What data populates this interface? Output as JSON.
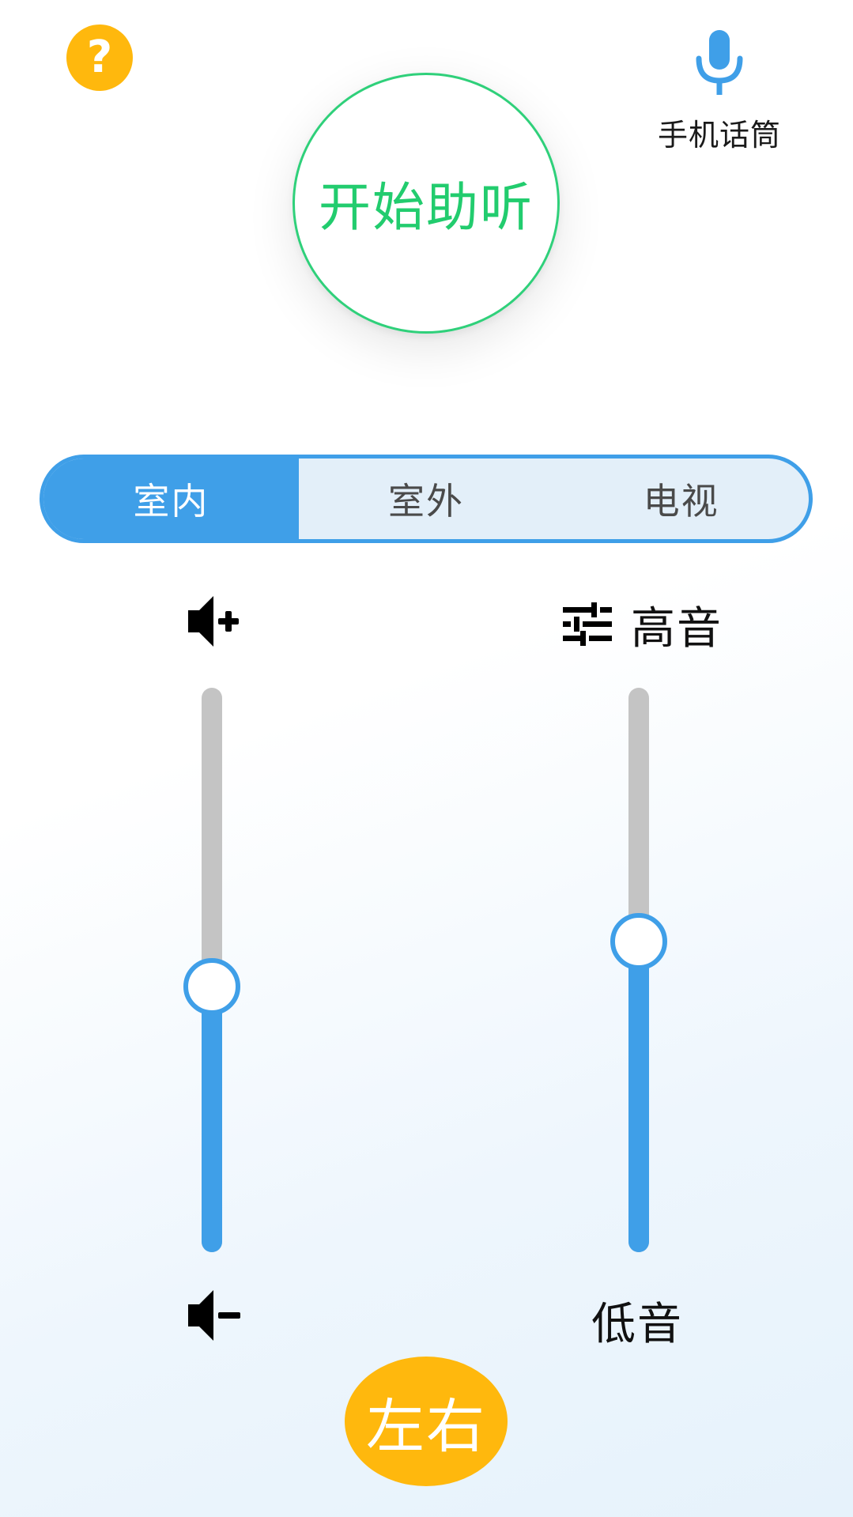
{
  "header": {
    "help_glyph": "?",
    "mic_label": "手机话筒"
  },
  "start_button": {
    "label": "开始助听"
  },
  "modes": {
    "items": [
      {
        "label": "室内",
        "active": true
      },
      {
        "label": "室外",
        "active": false
      },
      {
        "label": "电视",
        "active": false
      }
    ]
  },
  "volume": {
    "top_icon": "volume-up-icon",
    "bottom_icon": "volume-down-icon",
    "level_fraction": 0.47
  },
  "tone": {
    "top_label": "高音",
    "bottom_label": "低音",
    "top_icon": "equalizer-icon",
    "level_fraction": 0.55
  },
  "channel_button": {
    "label": "左右"
  },
  "colors": {
    "accent_blue": "#3f9fe8",
    "start_green": "#22cc6e",
    "yellow": "#ffb80d",
    "track_gray": "#c4c4c4"
  }
}
